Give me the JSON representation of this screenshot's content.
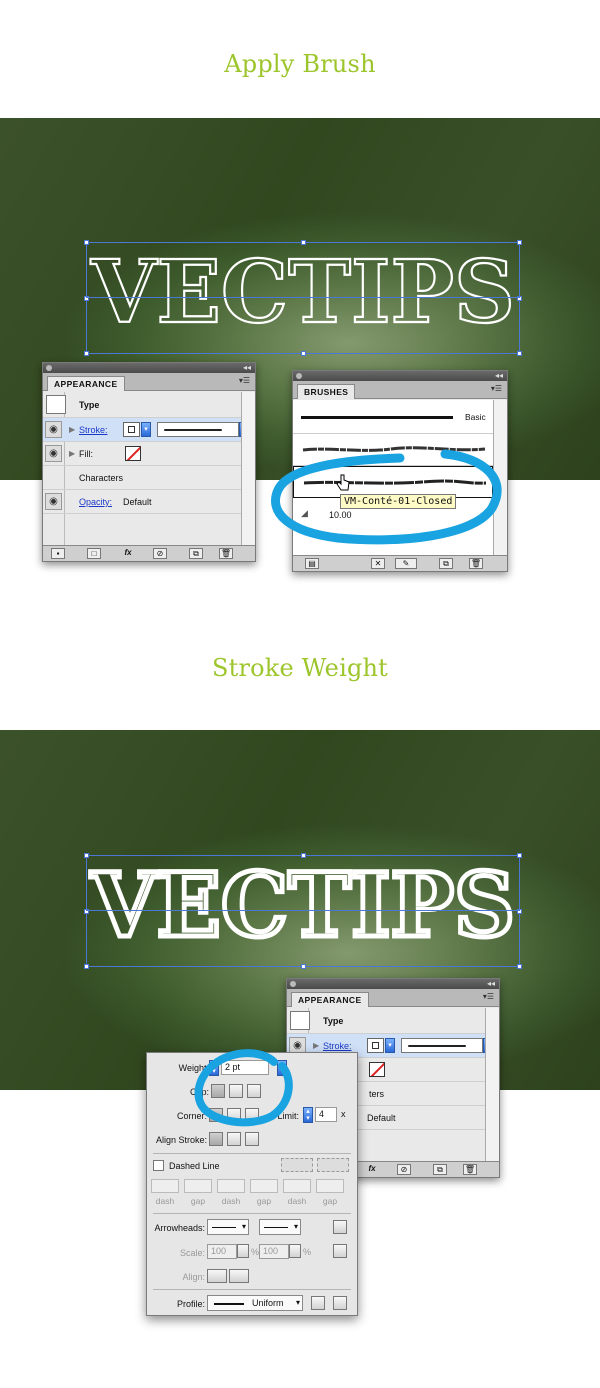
{
  "section1": {
    "title": "Apply Brush"
  },
  "section2": {
    "title": "Stroke Weight"
  },
  "artwork": {
    "text": "VECTIPS"
  },
  "appearance_panel": {
    "tab": "APPEARANCE",
    "rows": {
      "type": "Type",
      "stroke": "Stroke:",
      "fill": "Fill:",
      "characters": "Characters",
      "characters_partial": "ters",
      "opacity": "Opacity:",
      "opacity_value": "Default",
      "default_partial": "Default"
    },
    "bottom_icons": [
      "new-art-icon",
      "clear-appearance-icon",
      "fx-icon",
      "delete-icon",
      "duplicate-icon",
      "trash-icon"
    ],
    "fx": "fx"
  },
  "brushes_panel": {
    "tab": "BRUSHES",
    "basic": "Basic",
    "size": "10.00",
    "tooltip": "VM-Conté-01-Closed"
  },
  "stroke_panel": {
    "weight_label": "Weight:",
    "weight_value": "2 pt",
    "cap_label": "Cap:",
    "corner_label": "Corner:",
    "limit_label": "Limit:",
    "limit_value": "4",
    "limit_unit": "x",
    "align_label": "Align Stroke:",
    "dashed_label": "Dashed Line",
    "dash_labels": [
      "dash",
      "gap",
      "dash",
      "gap",
      "dash",
      "gap"
    ],
    "arrowheads_label": "Arrowheads:",
    "scale_label": "Scale:",
    "scale_values": [
      "100",
      "100"
    ],
    "percent": "%",
    "align_arrows_label": "Align:",
    "profile_label": "Profile:",
    "profile_value": "Uniform"
  },
  "colors": {
    "title": "#9dc52c",
    "highlight": "#19a3e0",
    "selection": "#4b78d6"
  }
}
